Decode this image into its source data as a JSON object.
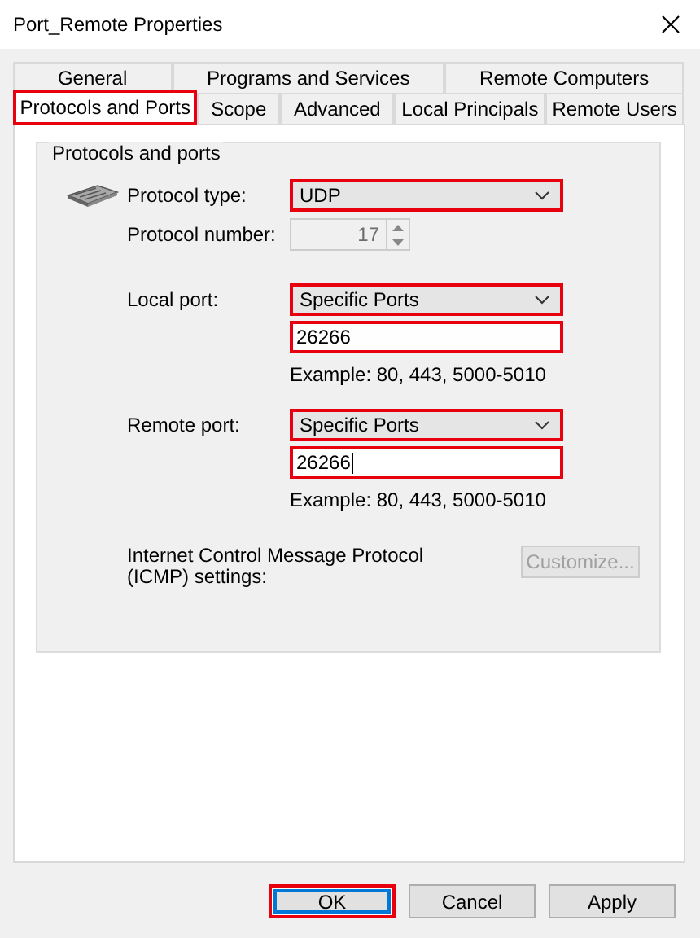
{
  "window": {
    "title": "Port_Remote Properties"
  },
  "tab_rows": [
    [
      {
        "label": "General",
        "selected": false,
        "highlighted": false
      },
      {
        "label": "Programs and Services",
        "selected": false,
        "highlighted": false
      },
      {
        "label": "Remote Computers",
        "selected": false,
        "highlighted": false
      }
    ],
    [
      {
        "label": "Protocols and Ports",
        "selected": true,
        "highlighted": true
      },
      {
        "label": "Scope",
        "selected": false,
        "highlighted": false
      },
      {
        "label": "Advanced",
        "selected": false,
        "highlighted": false
      },
      {
        "label": "Local Principals",
        "selected": false,
        "highlighted": false
      },
      {
        "label": "Remote Users",
        "selected": false,
        "highlighted": false
      }
    ]
  ],
  "group": {
    "title": "Protocols and ports",
    "protocol_type": {
      "label": "Protocol type:",
      "value": "UDP",
      "highlighted": true
    },
    "protocol_number": {
      "label": "Protocol number:",
      "value": "17",
      "disabled": true
    },
    "ports": [
      {
        "label": "Local port:",
        "value": "Specific Ports",
        "highlighted": true,
        "field_value": "26266",
        "field_highlighted": true,
        "focused": false,
        "example": "Example: 80, 443, 5000-5010"
      },
      {
        "label": "Remote port:",
        "value": "Specific Ports",
        "highlighted": true,
        "field_value": "26266",
        "field_highlighted": true,
        "focused": true,
        "example": "Example: 80, 443, 5000-5010"
      }
    ],
    "icmp": {
      "label": "Internet Control Message Protocol (ICMP) settings:",
      "button": "Customize...",
      "disabled": true
    }
  },
  "buttons": [
    {
      "label": "OK",
      "default": true,
      "highlighted": true
    },
    {
      "label": "Cancel",
      "default": false,
      "highlighted": false
    },
    {
      "label": "Apply",
      "default": false,
      "highlighted": false
    }
  ]
}
